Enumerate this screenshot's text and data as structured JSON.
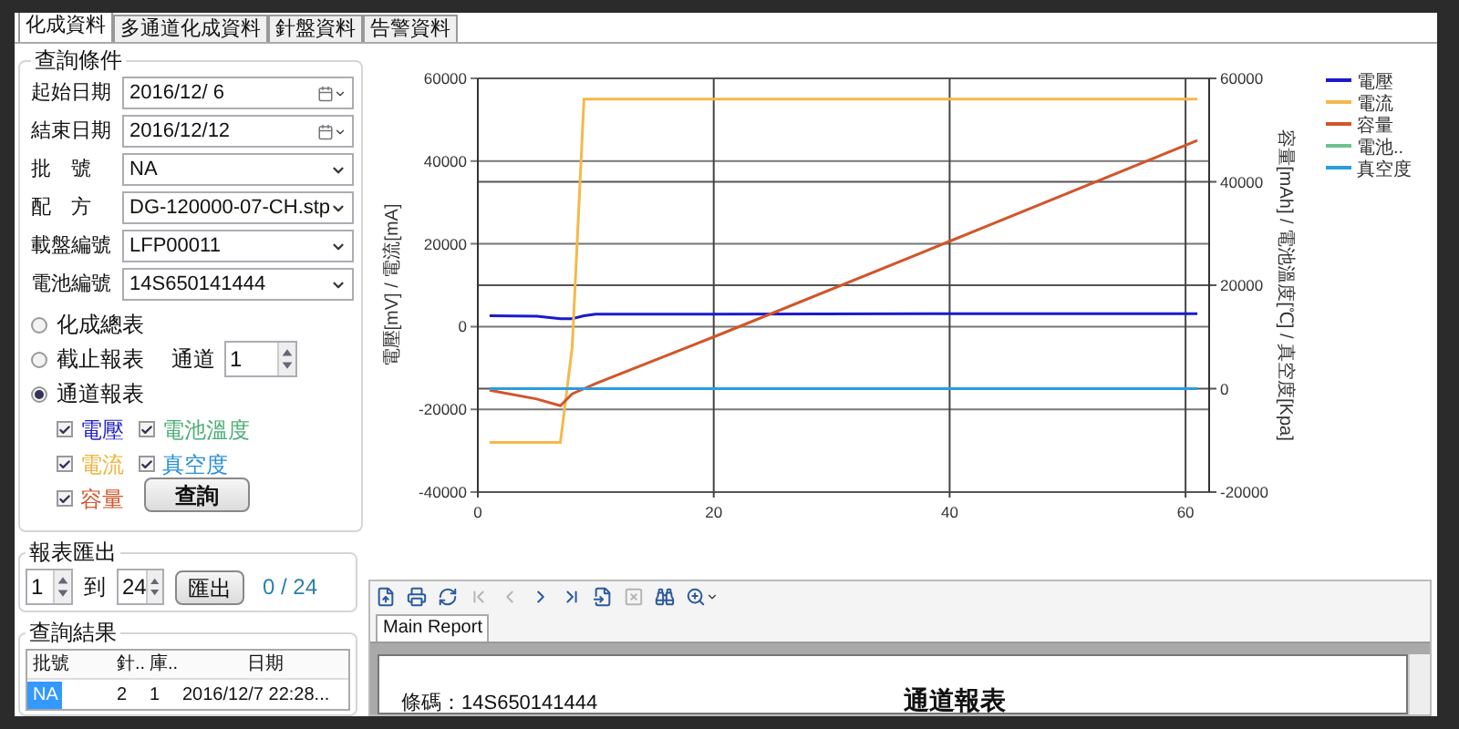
{
  "tabs": [
    {
      "label": "化成資料",
      "selected": true
    },
    {
      "label": "多通道化成資料",
      "selected": false
    },
    {
      "label": "針盤資料",
      "selected": false
    },
    {
      "label": "告警資料",
      "selected": false
    }
  ],
  "query": {
    "title": "查詢條件",
    "fields": [
      {
        "label": "起始日期",
        "value": "2016/12/ 6",
        "kind": "date"
      },
      {
        "label": "結束日期",
        "value": "2016/12/12",
        "kind": "date"
      },
      {
        "label": "批　號",
        "value": "NA",
        "kind": "select"
      },
      {
        "label": "配　方",
        "value": "DG-120000-07-CH.stp",
        "kind": "select"
      },
      {
        "label": "載盤編號",
        "value": "LFP00011",
        "kind": "select"
      },
      {
        "label": "電池編號",
        "value": "14S650141444",
        "kind": "select"
      }
    ],
    "reports": [
      {
        "label": "化成總表",
        "selected": false
      },
      {
        "label": "截止報表",
        "selected": false,
        "channel_label": "通道",
        "channel_value": "1"
      },
      {
        "label": "通道報表",
        "selected": true
      }
    ],
    "options": [
      {
        "label": "電壓",
        "checked": true,
        "color": "#2323c8"
      },
      {
        "label": "電池溫度",
        "checked": true,
        "color": "#4fae79"
      },
      {
        "label": "電流",
        "checked": true,
        "color": "#f0b43c"
      },
      {
        "label": "真空度",
        "checked": true,
        "color": "#2a8fd8"
      },
      {
        "label": "容量",
        "checked": true,
        "color": "#d2552a"
      }
    ],
    "button": "查詢"
  },
  "export": {
    "title": "報表匯出",
    "from": "1",
    "to_label": "到",
    "to": "24",
    "button": "匯出",
    "progress": "0 / 24"
  },
  "results": {
    "title": "查詢結果",
    "columns": [
      "批號",
      "針..",
      "庫..",
      "日期"
    ],
    "rows": [
      {
        "cells": [
          "NA",
          "2",
          "1",
          "2016/12/7 22:28..."
        ],
        "selected": true
      }
    ]
  },
  "chart_data": {
    "type": "line",
    "grid": true,
    "legend": true,
    "xlim": [
      0,
      62
    ],
    "ylim": [
      -40000,
      60000
    ],
    "xticks": [
      0,
      20,
      40,
      60
    ],
    "yticks": [
      -40000,
      -20000,
      0,
      20000,
      40000,
      60000
    ],
    "ylabel": "電壓[mV] / 電流[mA]",
    "y2label": "容量[mAh] / 電池溫度[℃] / 真空度[Kpa]",
    "y2lim": [
      -20000,
      60000
    ],
    "y2ticks": [
      -20000,
      0,
      20000,
      40000,
      60000
    ],
    "x": [
      1,
      5,
      7,
      8,
      9,
      10,
      20,
      40,
      61
    ],
    "series": [
      {
        "name": "電壓",
        "color": "#1a1acc",
        "axis": "y",
        "values": [
          2600,
          2500,
          1900,
          1900,
          2600,
          3000,
          3000,
          3100,
          3100
        ]
      },
      {
        "name": "電流",
        "color": "#f5b94a",
        "axis": "y",
        "values": [
          -28000,
          -28000,
          -28000,
          -5000,
          55000,
          55000,
          55000,
          55000,
          55000
        ]
      },
      {
        "name": "容量",
        "color": "#d2552a",
        "axis": "y2",
        "values": [
          -300,
          -2000,
          -3300,
          -1000,
          0,
          1000,
          10000,
          28500,
          48000
        ]
      },
      {
        "name": "電池..",
        "color": "#6fc08f",
        "axis": "y2",
        "values": [
          null,
          null,
          null,
          null,
          null,
          null,
          null,
          null,
          null
        ]
      },
      {
        "name": "真空度",
        "color": "#2a9de0",
        "axis": "y2",
        "values": [
          0,
          0,
          0,
          0,
          0,
          0,
          0,
          0,
          0
        ]
      }
    ]
  },
  "report_viewer": {
    "toolbar": [
      {
        "kind": "export",
        "disabled": false
      },
      {
        "kind": "print",
        "disabled": false
      },
      {
        "kind": "refresh",
        "disabled": false
      },
      {
        "kind": "first",
        "disabled": true
      },
      {
        "kind": "prev",
        "disabled": true
      },
      {
        "kind": "next",
        "disabled": false
      },
      {
        "kind": "last",
        "disabled": false
      },
      {
        "kind": "goto",
        "disabled": false
      },
      {
        "kind": "close",
        "disabled": true
      },
      {
        "kind": "find",
        "disabled": false
      },
      {
        "kind": "zoom",
        "disabled": false
      }
    ],
    "tabs": [
      {
        "label": "Main Report",
        "selected": true
      }
    ],
    "page_title": "通道報表",
    "page_line": "條碼：14S650141444"
  }
}
